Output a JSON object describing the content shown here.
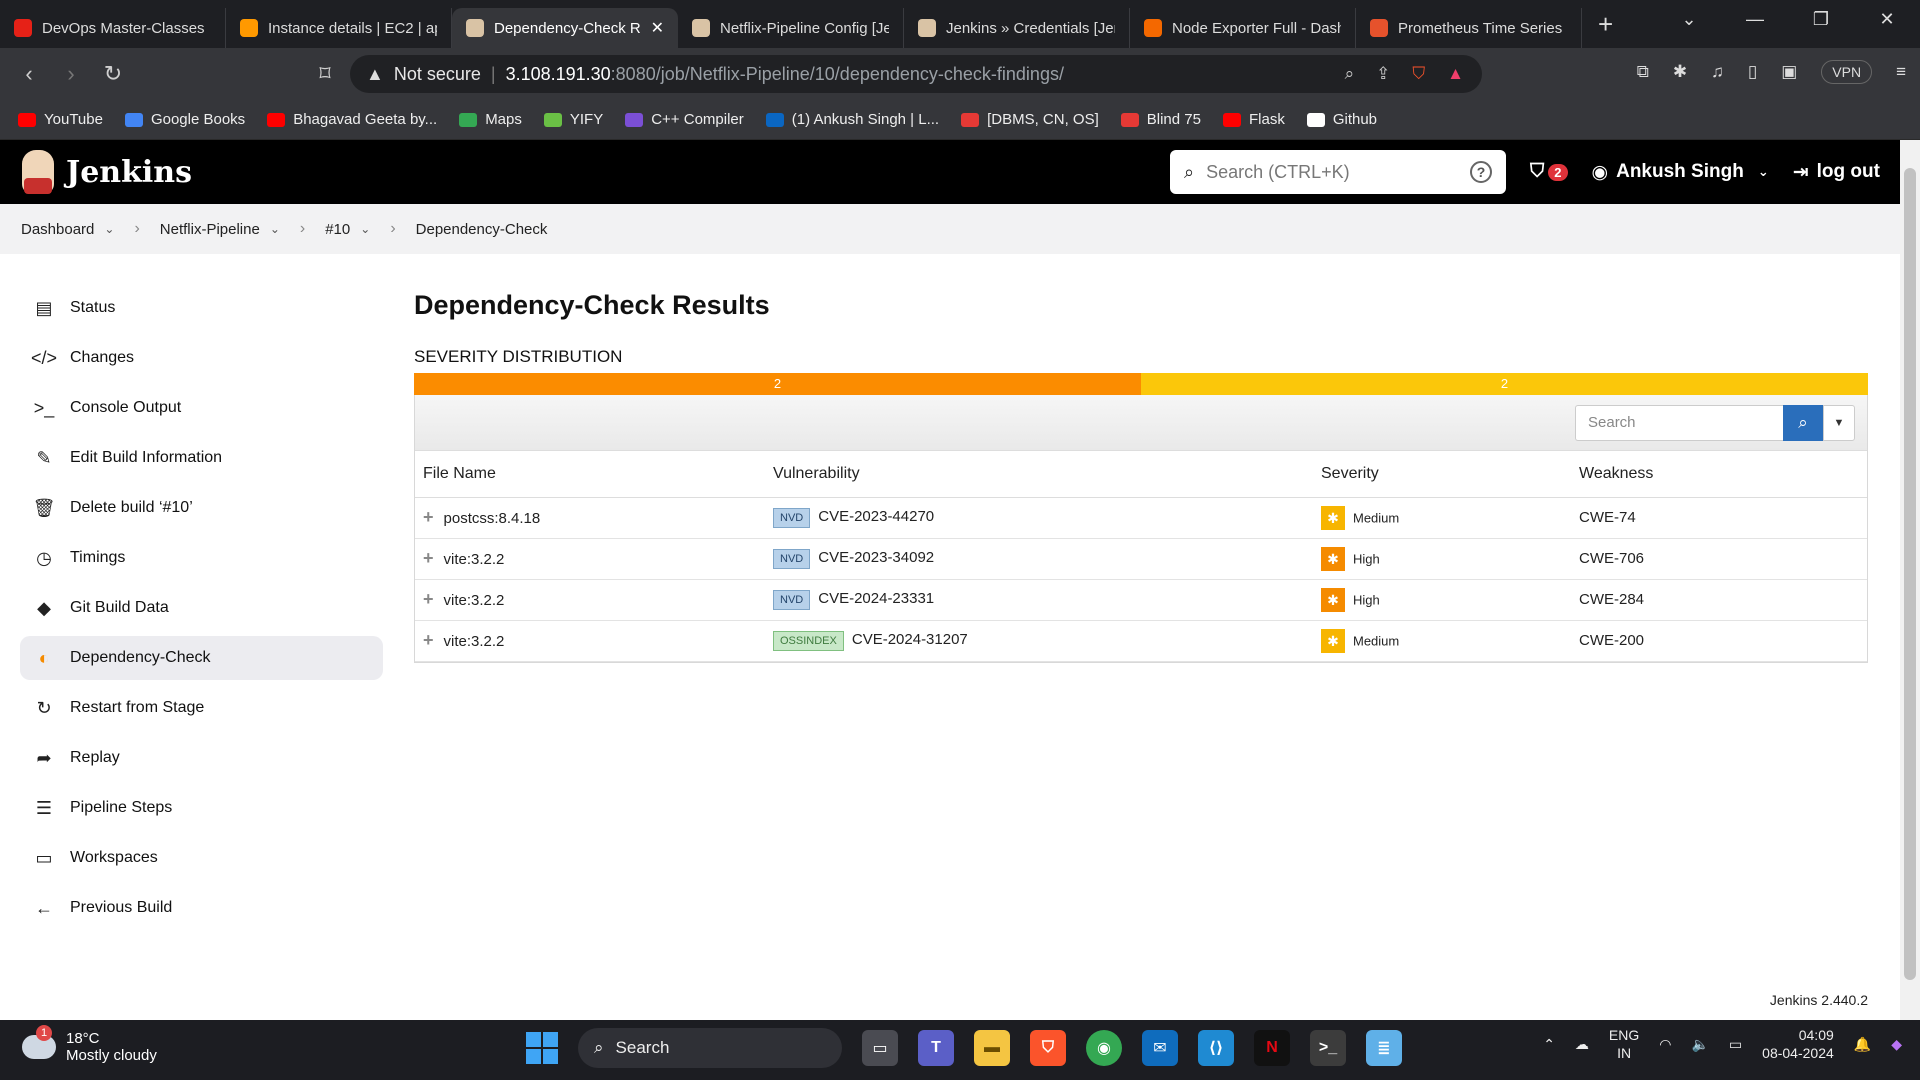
{
  "browser": {
    "tabs": [
      {
        "title": "DevOps Master-Classes",
        "color": "#e62117",
        "active": false
      },
      {
        "title": "Instance details | EC2 | ap",
        "color": "#ff9900",
        "active": false
      },
      {
        "title": "Dependency-Check R",
        "color": "#d9c3a5",
        "active": true
      },
      {
        "title": "Netflix-Pipeline Config [Je",
        "color": "#d9c3a5",
        "active": false
      },
      {
        "title": "Jenkins » Credentials [Jen",
        "color": "#d9c3a5",
        "active": false
      },
      {
        "title": "Node Exporter Full - Dash",
        "color": "#f46800",
        "active": false
      },
      {
        "title": "Prometheus Time Series C",
        "color": "#e6522c",
        "active": false
      }
    ],
    "address": {
      "security": "Not secure",
      "host": "3.108.191.30",
      "path": ":8080/job/Netflix-Pipeline/10/dependency-check-findings/"
    },
    "vpn_label": "VPN",
    "bookmarks": [
      {
        "label": "YouTube",
        "color": "#ff0000"
      },
      {
        "label": "Google Books",
        "color": "#4285f4"
      },
      {
        "label": "Bhagavad Geeta by...",
        "color": "#ff0000"
      },
      {
        "label": "Maps",
        "color": "#34a853"
      },
      {
        "label": "YIFY",
        "color": "#6ac045"
      },
      {
        "label": "C++ Compiler",
        "color": "#7b4fd6"
      },
      {
        "label": "(1) Ankush Singh | L...",
        "color": "#0a66c2"
      },
      {
        "label": "[DBMS, CN, OS]",
        "color": "#e53935"
      },
      {
        "label": "Blind 75",
        "color": "#e53935"
      },
      {
        "label": "Flask",
        "color": "#ff0000"
      },
      {
        "label": "Github",
        "color": "#ffffff"
      }
    ]
  },
  "jenkins": {
    "brand": "Jenkins",
    "search_placeholder": "Search (CTRL+K)",
    "help_glyph": "?",
    "alerts_count": "2",
    "user": "Ankush Singh",
    "logout": "log out",
    "breadcrumbs": [
      "Dashboard",
      "Netflix-Pipeline",
      "#10",
      "Dependency-Check"
    ],
    "sidebar": [
      {
        "label": "Status",
        "icon": "status-icon",
        "glyph": "▤"
      },
      {
        "label": "Changes",
        "icon": "code-icon",
        "glyph": "</>"
      },
      {
        "label": "Console Output",
        "icon": "terminal-icon",
        "glyph": ">_"
      },
      {
        "label": "Edit Build Information",
        "icon": "edit-icon",
        "glyph": "✎"
      },
      {
        "label": "Delete build ‘#10’",
        "icon": "trash-icon",
        "glyph": "🗑"
      },
      {
        "label": "Timings",
        "icon": "clock-icon",
        "glyph": "◷"
      },
      {
        "label": "Git Build Data",
        "icon": "git-icon",
        "glyph": "◆"
      },
      {
        "label": "Dependency-Check",
        "icon": "dependency-check-icon",
        "glyph": "◐"
      },
      {
        "label": "Restart from Stage",
        "icon": "restart-icon",
        "glyph": "↻"
      },
      {
        "label": "Replay",
        "icon": "replay-icon",
        "glyph": "➦"
      },
      {
        "label": "Pipeline Steps",
        "icon": "list-icon",
        "glyph": "☰"
      },
      {
        "label": "Workspaces",
        "icon": "folder-icon",
        "glyph": "▭"
      },
      {
        "label": "Previous Build",
        "icon": "arrow-left-icon",
        "glyph": "←"
      }
    ],
    "active_sidebar_index": 7,
    "page_title": "Dependency-Check Results",
    "severity_label": "SEVERITY DISTRIBUTION",
    "severity": {
      "high": "2",
      "medium": "2"
    },
    "table_search_placeholder": "Search",
    "columns": [
      "File Name",
      "Vulnerability",
      "Severity",
      "Weakness"
    ],
    "rows": [
      {
        "file": "postcss:8.4.18",
        "source": "NVD",
        "cve": "CVE-2023-44270",
        "severity": "Medium",
        "weakness": "CWE-74"
      },
      {
        "file": "vite:3.2.2",
        "source": "NVD",
        "cve": "CVE-2023-34092",
        "severity": "High",
        "weakness": "CWE-706"
      },
      {
        "file": "vite:3.2.2",
        "source": "NVD",
        "cve": "CVE-2024-23331",
        "severity": "High",
        "weakness": "CWE-284"
      },
      {
        "file": "vite:3.2.2",
        "source": "OSSINDEX",
        "cve": "CVE-2024-31207",
        "severity": "Medium",
        "weakness": "CWE-200"
      }
    ],
    "version": "Jenkins 2.440.2"
  },
  "taskbar": {
    "temp": "18°C",
    "weather": "Mostly cloudy",
    "search": "Search",
    "lang1": "ENG",
    "lang2": "IN",
    "time": "04:09",
    "date": "08-04-2024"
  }
}
